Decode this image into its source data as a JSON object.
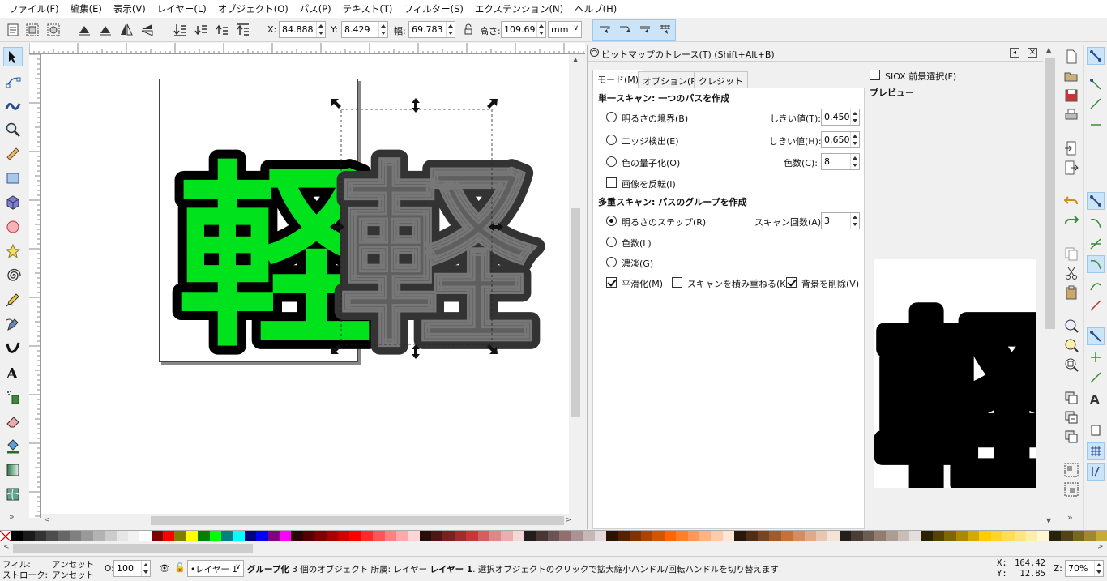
{
  "menu": [
    "ファイル(F)",
    "編集(E)",
    "表示(V)",
    "レイヤー(L)",
    "オブジェクト(O)",
    "パス(P)",
    "テキスト(T)",
    "フィルター(S)",
    "エクステンション(N)",
    "ヘルプ(H)"
  ],
  "toolbar": {
    "x_label": "X:",
    "x_value": "84.888",
    "y_label": "Y:",
    "y_value": "8.429",
    "w_label": "幅:",
    "w_value": "69.783",
    "h_label": "高さ:",
    "h_value": "109.692",
    "unit": "mm"
  },
  "canvas": {
    "glyph": "軽",
    "green": "#00e21c",
    "gray": "#5f5f5f",
    "dark": "#333333"
  },
  "dialog": {
    "title": "ビットマップのトレース(T) (Shift+Alt+B)",
    "tabs": [
      "モード(M)",
      "オプション(P)",
      "クレジット"
    ],
    "single_scan_header": "単一スキャン: 一つのパスを作成",
    "brightness_cutoff": "明るさの境界(B)",
    "threshold_label_1": "しきい値(T):",
    "threshold_value_1": "0.450",
    "edge_detection": "エッジ検出(E)",
    "threshold_label_2": "しきい値(H):",
    "threshold_value_2": "0.650",
    "color_quantization": "色の量子化(O)",
    "colors_label": "色数(C):",
    "colors_value": "8",
    "invert_image": "画像を反転(I)",
    "multi_scan_header": "多重スキャン: パスのグループを作成",
    "brightness_steps": "明るさのステップ(R)",
    "scans_label": "スキャン回数(A):",
    "scans_value": "3",
    "colors": "色数(L)",
    "grays": "濃淡(G)",
    "smooth": "平滑化(M)",
    "stack_scans": "スキャンを積み重ねる(K)",
    "remove_background": "背景を削除(V)",
    "siox": "SIOX 前景選択(F)",
    "preview_label": "プレビュー"
  },
  "palette": [
    "#000000",
    "#1a1a1a",
    "#333333",
    "#4d4d4d",
    "#666666",
    "#808080",
    "#999999",
    "#b3b3b3",
    "#cccccc",
    "#e6e6e6",
    "#f2f2f2",
    "#ffffff",
    "#800000",
    "#ff0000",
    "#808000",
    "#ffff00",
    "#008000",
    "#00ff00",
    "#008080",
    "#00ffff",
    "#000080",
    "#0000ff",
    "#800080",
    "#ff00ff",
    "#2b0000",
    "#550000",
    "#800000",
    "#aa0000",
    "#d40000",
    "#ff0000",
    "#ff2a2a",
    "#ff5555",
    "#ff8080",
    "#ffaaaa",
    "#ffd5d5",
    "#280b0b",
    "#501616",
    "#782121",
    "#a02c2c",
    "#c83737",
    "#d35f5f",
    "#de8787",
    "#e9afaf",
    "#f4d7d7",
    "#241c1c",
    "#483737",
    "#6c5353",
    "#916f6f",
    "#ac9393",
    "#c8b7b7",
    "#e3dbdb",
    "#2b1100",
    "#552200",
    "#803300",
    "#aa4400",
    "#d45500",
    "#ff6600",
    "#ff7f2a",
    "#ff9955",
    "#ffb380",
    "#ffccaa",
    "#ffe6d5",
    "#28170b",
    "#502d16",
    "#784421",
    "#a05a2c",
    "#c87137",
    "#d38d5f",
    "#deaa87",
    "#e9c6af",
    "#f4e3d7",
    "#241f1c",
    "#483e37",
    "#6c5d53",
    "#917c6f",
    "#ac9d93",
    "#c8beb7",
    "#e3dedb",
    "#2b2200",
    "#554400",
    "#806600",
    "#aa8800",
    "#d4aa00",
    "#ffcc00",
    "#ffd42a",
    "#ffdd55",
    "#ffe680",
    "#ffeeaa",
    "#fff6d5",
    "#28220b",
    "#504416",
    "#786721",
    "#a0892c",
    "#c8ab37"
  ],
  "status": {
    "fill_label": "フィル:",
    "fill_value": "アンセット",
    "stroke_label": "ストローク:",
    "stroke_value": "アンセット",
    "opacity_label": "O:",
    "opacity_value": "100",
    "layer": "•レイヤー 1",
    "message_prefix": "グループ化",
    "message": " 3 個のオブジェクト 所属: レイヤー ",
    "layer_bold": "レイヤー 1",
    "message_suffix": ". 選択オブジェクトのクリックで拡大縮小ハンドル/回転ハンドルを切り替えます.",
    "x_label": "X:",
    "x_value": "164.42",
    "y_label": "Y:",
    "y_value": "12.85",
    "zoom_label": "Z:",
    "zoom_value": "70%"
  }
}
